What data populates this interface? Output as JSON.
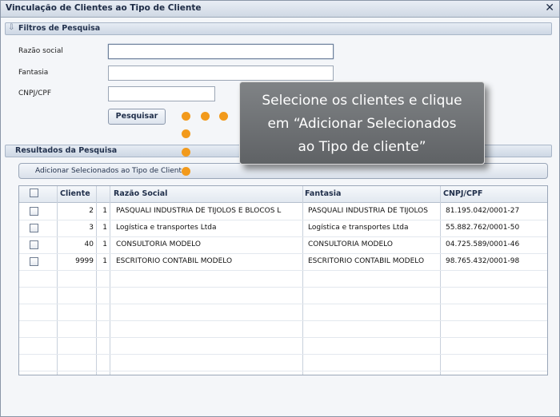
{
  "window": {
    "title": "Vinculação de Clientes ao Tipo de Cliente",
    "close": "✕"
  },
  "filters": {
    "header": "Filtros de Pesquisa",
    "razao_label": "Razão social",
    "fantasia_label": "Fantasia",
    "cnpj_label": "CNPJ/CPF",
    "razao_value": "",
    "fantasia_value": "",
    "cnpj_value": "",
    "search_button": "Pesquisar"
  },
  "results": {
    "header": "Resultados da Pesquisa",
    "add_button": "Adicionar Selecionados ao Tipo de Cliente",
    "columns": [
      "Cliente",
      "Razão Social",
      "Fantasia",
      "CNPJ/CPF"
    ],
    "rows": [
      {
        "cliente": "2",
        "flag": "1",
        "razao": "PASQUALI INDUSTRIA DE TIJOLOS E BLOCOS L",
        "fantasia": "PASQUALI INDUSTRIA DE TIJOLOS",
        "cnpj": "81.195.042/0001-27"
      },
      {
        "cliente": "3",
        "flag": "1",
        "razao": "Logística e transportes Ltda",
        "fantasia": "Logística e transportes Ltda",
        "cnpj": "55.882.762/0001-50"
      },
      {
        "cliente": "40",
        "flag": "1",
        "razao": "CONSULTORIA MODELO",
        "fantasia": "CONSULTORIA MODELO",
        "cnpj": "04.725.589/0001-46"
      },
      {
        "cliente": "9999",
        "flag": "1",
        "razao": "ESCRITORIO CONTABIL MODELO",
        "fantasia": "ESCRITORIO CONTABIL MODELO",
        "cnpj": "98.765.432/0001-98"
      }
    ]
  },
  "tooltip": {
    "line1": "Selecione os clientes e clique",
    "line2": "em “Adicionar Selecionados",
    "line3": "ao Tipo de cliente”"
  },
  "colors": {
    "accent_dot": "#f29a1c",
    "tooltip_bg": "#6f7275"
  }
}
